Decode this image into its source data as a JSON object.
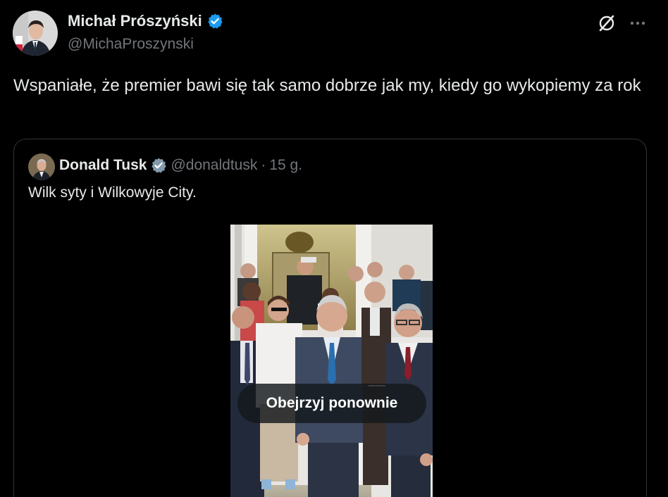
{
  "author": {
    "display_name": "Michał Prószyński",
    "handle": "@MichaProszynski",
    "verified_icon": "verified-badge-icon"
  },
  "actions": {
    "grok_icon": "grok-icon",
    "more_icon": "more-options-icon"
  },
  "tweet": {
    "text": "Wspaniałe, że premier bawi się tak samo dobrze jak my, kiedy go wykopiemy za rok"
  },
  "quoted": {
    "display_name": "Donald Tusk",
    "handle": "@donaldtusk",
    "separator": "·",
    "time": "15 g.",
    "text": "Wilk syty i Wilkowyje City.",
    "verified_icon": "verified-badge-icon"
  },
  "media": {
    "replay_label": "Obejrzyj ponownie"
  },
  "colors": {
    "background": "#000000",
    "text_primary": "#e7e9ea",
    "text_secondary": "#71767b",
    "border": "#2f3336",
    "verified_blue": "#1d9bf0",
    "quoted_verified_gray": "#829aab"
  }
}
